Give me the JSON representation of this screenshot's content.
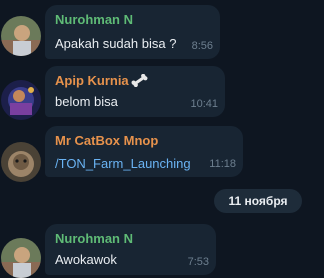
{
  "messages": [
    {
      "sender": "Nurohman N",
      "sender_color": "#5fbb76",
      "text": "Apakah sudah bisa ?",
      "time": "8:56",
      "avatar": "user-photo-avatar"
    },
    {
      "sender": "Apip Kurnia",
      "sender_color": "#e7924c",
      "text": "belom bisa",
      "time": "10:41",
      "avatar": "user-photo-avatar",
      "badge_icon": "bone-icon"
    },
    {
      "sender": "Mr CatBox Mnop",
      "sender_color": "#e7924c",
      "text": "/TON_Farm_Launching",
      "text_color": "#6ab3f3",
      "time": "11:18",
      "avatar": "user-photo-avatar"
    },
    {
      "sender": "Nurohman N",
      "sender_color": "#5fbb76",
      "text": "Awokawok",
      "time": "7:53",
      "avatar": "user-photo-avatar"
    }
  ],
  "date_separator": "11 ноября",
  "colors": {
    "background": "#0e1621",
    "bubble": "#182533",
    "text": "#e9edf1",
    "time": "#6d7f8f",
    "link": "#6ab3f3"
  }
}
